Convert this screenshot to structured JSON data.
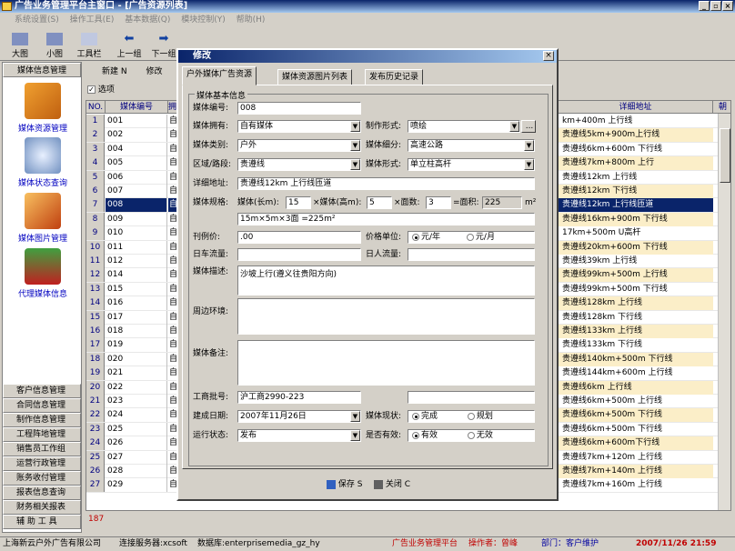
{
  "window": {
    "title": "广告业务管理平台主窗口 - [广告资源列表]"
  },
  "menu": [
    "系统设置(S)",
    "操作工具(E)",
    "基本数据(Q)",
    "模块控制(Y)",
    "帮助(H)"
  ],
  "toolbar": [
    "大图",
    "小图",
    "工具栏",
    "上一组",
    "下一组"
  ],
  "nav": {
    "header": "媒体信息管理",
    "big_items": [
      "媒体资源管理",
      "媒体状态查询",
      "媒体图片管理",
      "代理媒体信息"
    ],
    "modules": [
      "客户信息管理",
      "合同信息管理",
      "制作信息管理",
      "工程阵地管理",
      "销售员工作组",
      "运营行政管理",
      "账务收付管理",
      "报表信息查询",
      "财务相关报表",
      "辅 助 工 具"
    ]
  },
  "list_toolbar": {
    "new": "新建 N",
    "edit": "修改",
    "select": "选项"
  },
  "grid": {
    "headers": [
      "NO.",
      "媒体编号",
      "拥",
      "详细地址",
      "朝"
    ],
    "rows": [
      {
        "n": "1",
        "code": "001",
        "owner": "自",
        "addr": "km+400m 上行线"
      },
      {
        "n": "2",
        "code": "002",
        "owner": "自",
        "addr": "贵遵线5km+900m上行线"
      },
      {
        "n": "3",
        "code": "004",
        "owner": "自",
        "addr": "贵遵线6km+600m 下行线"
      },
      {
        "n": "4",
        "code": "005",
        "owner": "自",
        "addr": "贵遵线7km+800m 上行"
      },
      {
        "n": "5",
        "code": "006",
        "owner": "自",
        "addr": "贵遵线12km 上行线"
      },
      {
        "n": "6",
        "code": "007",
        "owner": "自",
        "addr": "贵遵线12km 下行线"
      },
      {
        "n": "7",
        "code": "008",
        "owner": "自",
        "addr": "贵遵线12km 上行线匝道"
      },
      {
        "n": "8",
        "code": "009",
        "owner": "自",
        "addr": "贵遵线16km+900m 下行线"
      },
      {
        "n": "9",
        "code": "010",
        "owner": "自",
        "addr": "17km+500m U高杆"
      },
      {
        "n": "10",
        "code": "011",
        "owner": "自",
        "addr": "贵遵线20km+600m 下行线"
      },
      {
        "n": "11",
        "code": "012",
        "owner": "自",
        "addr": "贵遵线39km 上行线"
      },
      {
        "n": "12",
        "code": "014",
        "owner": "自",
        "addr": "贵遵线99km+500m 上行线"
      },
      {
        "n": "13",
        "code": "015",
        "owner": "自",
        "addr": "贵遵线99km+500m 下行线"
      },
      {
        "n": "14",
        "code": "016",
        "owner": "自",
        "addr": "贵遵线128km 上行线"
      },
      {
        "n": "15",
        "code": "017",
        "owner": "自",
        "addr": "贵遵线128km 下行线"
      },
      {
        "n": "16",
        "code": "018",
        "owner": "自",
        "addr": "贵遵线133km 上行线"
      },
      {
        "n": "17",
        "code": "019",
        "owner": "自",
        "addr": "贵遵线133km 下行线"
      },
      {
        "n": "18",
        "code": "020",
        "owner": "自",
        "addr": "贵遵线140km+500m 下行线"
      },
      {
        "n": "19",
        "code": "021",
        "owner": "自",
        "addr": "贵遵线144km+600m 上行线"
      },
      {
        "n": "20",
        "code": "022",
        "owner": "自",
        "addr": "贵遵线6km 上行线"
      },
      {
        "n": "21",
        "code": "023",
        "owner": "自",
        "addr": "贵遵线6km+500m 上行线"
      },
      {
        "n": "22",
        "code": "024",
        "owner": "自",
        "addr": "贵遵线6km+500m 下行线"
      },
      {
        "n": "23",
        "code": "025",
        "owner": "自",
        "addr": "贵遵线6km+500m 下行线"
      },
      {
        "n": "24",
        "code": "026",
        "owner": "自",
        "addr": "贵遵线6km+600m下行线"
      },
      {
        "n": "25",
        "code": "027",
        "owner": "自",
        "addr": "贵遵线7km+120m 上行线"
      },
      {
        "n": "26",
        "code": "028",
        "owner": "自",
        "addr": "贵遵线7km+140m 上行线"
      },
      {
        "n": "27",
        "code": "029",
        "owner": "自",
        "addr": "贵遵线7km+160m 上行线"
      }
    ],
    "count": "187"
  },
  "status": {
    "company": "上海新云户外广告有限公司",
    "server": "连接服务器:xcsoft",
    "db": "数据库:enterprisemedia_gz_hy",
    "platform": "广告业务管理平台",
    "operator": "操作者：曾峰",
    "dept": "部门：客户维护",
    "datetime": "2007/11/26 21:59"
  },
  "dialog": {
    "title": "修改",
    "tabs": [
      "户外媒体广告资源",
      "媒体资源图片列表",
      "发布历史记录"
    ],
    "group": "媒体基本信息",
    "labels": {
      "code": "媒体编号:",
      "owner": "媒体拥有:",
      "make": "制作形式:",
      "type": "媒体类别:",
      "sub": "媒体细分:",
      "area": "区域/路段:",
      "form": "媒体形式:",
      "addr": "详细地址:",
      "spec": "媒体规格:",
      "w": "媒体(长m):",
      "h": "×媒体(高m):",
      "faces": "×面数:",
      "sqm": "=面积:",
      "unit": "m²",
      "price": "刊例价:",
      "price_unit": "价格单位:",
      "day": "日车流量:",
      "people": "日人流量:",
      "desc": "媒体描述:",
      "env": "周边环境:",
      "remark": "媒体备注:",
      "permit": "工商批号:",
      "date": "建成日期:",
      "state": "媒体现状:",
      "run": "运行状态:",
      "valid": "是否有效:"
    },
    "values": {
      "code": "008",
      "owner": "自有媒体",
      "make": "喷绘",
      "type": "户外",
      "sub": "高速公路",
      "area": "贵遵线",
      "form": "单立柱高杆",
      "addr": "贵遵线12km 上行线匝道",
      "w": "15",
      "h": "5",
      "faces": "3",
      "sqm": "225",
      "spec_text": "15m×5m×3面 =225m²",
      "price": ".00",
      "desc": "沙坡上行(遵义往贵阳方向)",
      "permit": "沪工商2990-223",
      "date": "2007年11月26日",
      "run": "发布"
    },
    "radios": {
      "unit_a": "元/年",
      "unit_b": "元/月",
      "state_a": "完成",
      "state_b": "规划",
      "valid_a": "有效",
      "valid_b": "无效"
    },
    "save": "保存 S",
    "close": "关闭 C"
  }
}
